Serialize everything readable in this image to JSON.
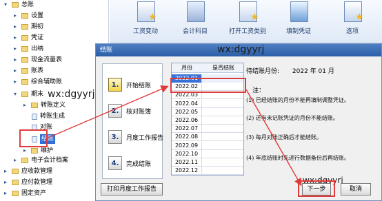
{
  "tree": {
    "items": [
      {
        "label": "总账",
        "type": "folder-open"
      },
      {
        "label": "设置",
        "type": "folder"
      },
      {
        "label": "期初",
        "type": "folder"
      },
      {
        "label": "凭证",
        "type": "folder"
      },
      {
        "label": "出纳",
        "type": "folder"
      },
      {
        "label": "现金流量表",
        "type": "folder"
      },
      {
        "label": "账表",
        "type": "folder"
      },
      {
        "label": "综合辅助账",
        "type": "folder"
      },
      {
        "label": "期末",
        "type": "folder-open"
      },
      {
        "label": "转账定义",
        "type": "folder"
      },
      {
        "label": "转账生成",
        "type": "leaf"
      },
      {
        "label": "对账",
        "type": "leaf"
      },
      {
        "label": "结账",
        "type": "leaf"
      },
      {
        "label": "维护",
        "type": "folder"
      },
      {
        "label": "电子会计档案",
        "type": "folder"
      },
      {
        "label": "应收款管理",
        "type": "folder"
      },
      {
        "label": "应付款管理",
        "type": "folder"
      },
      {
        "label": "固定资产",
        "type": "folder"
      }
    ],
    "watermark": "wx:dgyyrj"
  },
  "toolbar": {
    "buttons": [
      {
        "label": "工资变动",
        "icon": "payroll-icon"
      },
      {
        "label": "会计科目",
        "icon": "ledger-icon"
      },
      {
        "label": "打开工资类别",
        "icon": "open-folder-icon"
      },
      {
        "label": "填制凭证",
        "icon": "voucher-icon"
      },
      {
        "label": "选项",
        "icon": "options-icon"
      }
    ]
  },
  "dialog": {
    "title": "结账",
    "watermark": "wx:dgyyrj",
    "steps": [
      {
        "num": "1.",
        "label": "开始结账"
      },
      {
        "num": "2.",
        "label": "核对账簿"
      },
      {
        "num": "3.",
        "label": "月度工作报告"
      },
      {
        "num": "4.",
        "label": "完成结账"
      }
    ],
    "table": {
      "headers": [
        "月份",
        "是否结账"
      ],
      "rows": [
        "2022.01",
        "2022.02",
        "2022.03",
        "2022.04",
        "2022.05",
        "2022.06",
        "2022.07",
        "2022.08",
        "2022.09",
        "2022.10",
        "2022.11",
        "2022.12"
      ]
    },
    "info": {
      "pending_label": "待结账月份:",
      "pending_value": "2022 年 01 月",
      "note_heading": "注：",
      "notes": [
        "(1) 已经结账的月份不能再填制调整凭证。",
        "(2) 还有未记账凭证的月份不能结账。",
        "(3) 每月对账正确后才能结账。",
        "(4) 年底结账时先进行数据备份后再结账。"
      ]
    },
    "buttons": {
      "print_report": "打印月度工作报告",
      "next": "下一步",
      "cancel": "取消"
    },
    "watermark2": "wx:dgyyrj"
  },
  "colors": {
    "annotation": "#e03b3b",
    "selection": "#3972d6",
    "title_bar": "#2b5ea8"
  }
}
